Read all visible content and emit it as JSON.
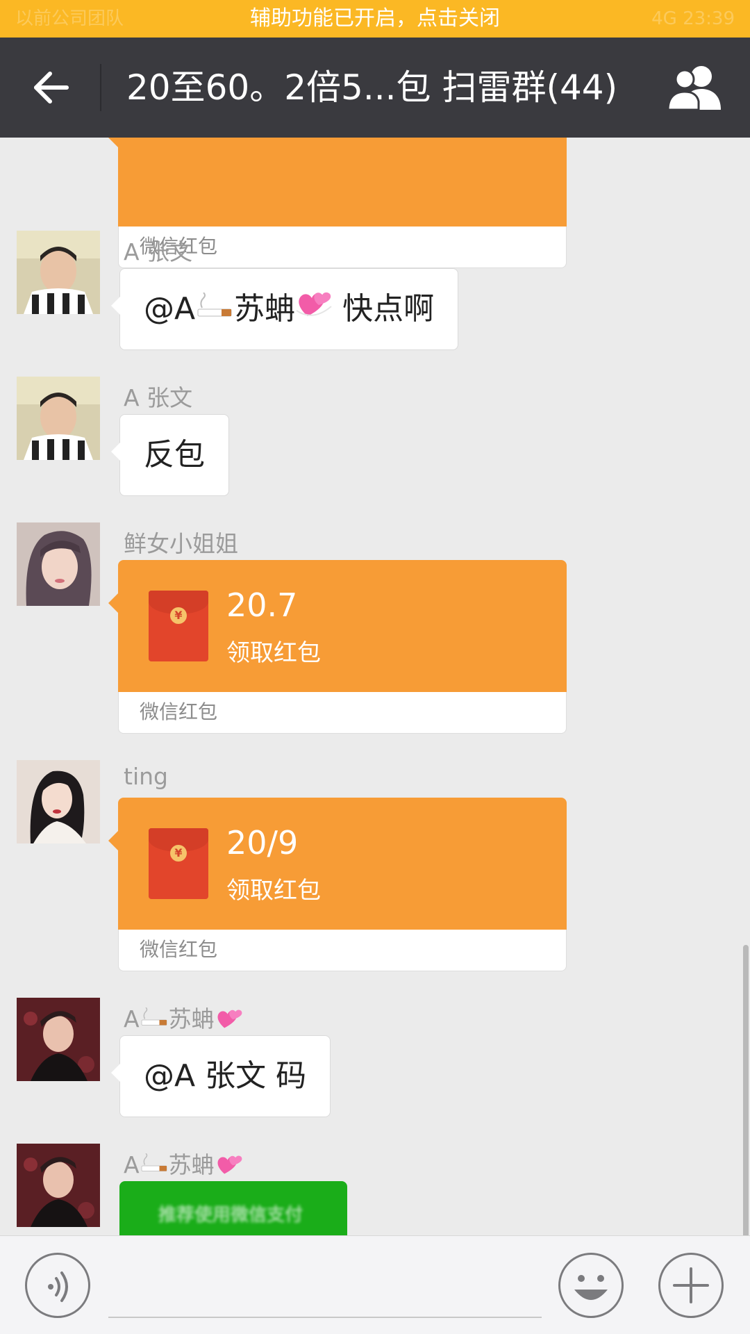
{
  "banner": {
    "text": "辅助功能已开启，点击关闭",
    "left_faded": "以前公司团队",
    "right_faded": "4G 23:39"
  },
  "header": {
    "title": "20至60。2倍5...包  扫雷群(44)",
    "back_icon": "arrow-left-icon",
    "group_icon": "group-people-icon"
  },
  "messages": [
    {
      "type": "redpacket-partial",
      "source": "微信红包"
    },
    {
      "type": "text",
      "sender": "A 张文",
      "text_parts": {
        "prefix": "@A",
        "name": "苏蚺",
        "suffix": "快点啊"
      }
    },
    {
      "type": "text",
      "sender": "A 张文",
      "text": "反包"
    },
    {
      "type": "redpacket",
      "sender": "鲜女小姐姐",
      "amount": "20.7",
      "action": "领取红包",
      "source": "微信红包"
    },
    {
      "type": "redpacket",
      "sender": "ting",
      "amount": "20/9",
      "action": "领取红包",
      "source": "微信红包"
    },
    {
      "type": "text",
      "sender_prefix": "A",
      "sender_name": "苏蚺",
      "text": "@A 张文  码"
    },
    {
      "type": "card",
      "sender_prefix": "A",
      "sender_name": "苏蚺",
      "card_text": "推荐使用微信支付"
    }
  ],
  "inputbar": {
    "voice_icon": "voice-icon",
    "emoji_icon": "smiley-icon",
    "plus_icon": "plus-icon",
    "input_value": ""
  },
  "colors": {
    "banner": "#fbb824",
    "header": "#3a3a3f",
    "redpacket": "#f79c36",
    "background": "#ebebeb",
    "card_green": "#1aad19"
  }
}
